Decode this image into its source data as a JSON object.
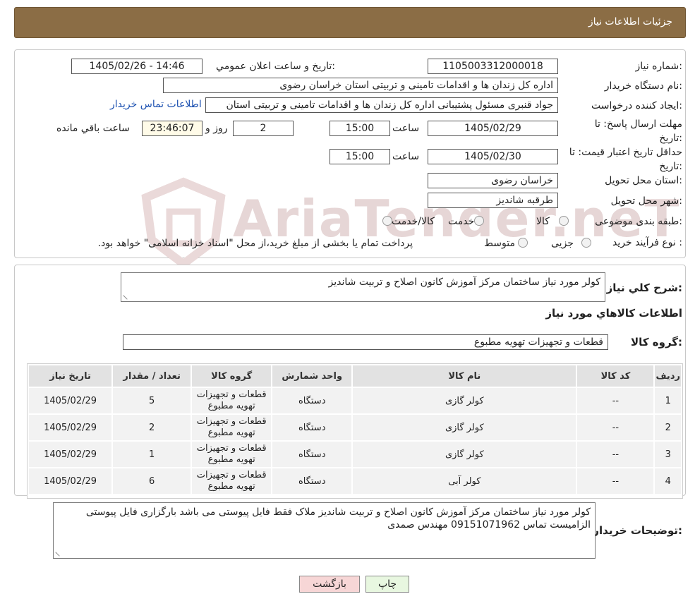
{
  "header": {
    "title": "جزئیات اطلاعات نیاز"
  },
  "watermark": "AriaTender.neT",
  "info": {
    "need_number_label": "شماره نیاز:",
    "need_number": "1105003312000018",
    "announce_label": "تاريخ و ساعت اعلان عمومي:",
    "announce_value": "1405/02/26 - 14:46",
    "buyer_org_label": "نام دستگاه خریدار:",
    "buyer_org": "اداره کل زندان ها و اقدامات تامینی و تربیتی استان خراسان رضوی",
    "creator_label": "ایجاد کننده درخواست:",
    "creator": "جواد قنبری مسئول پشتیبانی اداره کل زندان ها و اقدامات تامینی و تربیتی استان",
    "contact_link": "اطلاعات تماس خریدار",
    "deadline_label": "مهلت ارسال پاسخ: تا تاریخ:",
    "deadline_date": "1405/02/29",
    "time_label": "ساعت",
    "deadline_time": "15:00",
    "days": "2",
    "days_label": "روز و",
    "remaining": "23:46:07",
    "remaining_label": "ساعت باقي مانده",
    "validity_label": "حداقل تاریخ اعتبار قیمت: تا تاریخ:",
    "validity_date": "1405/02/30",
    "validity_time": "15:00",
    "province_label": "استان محل تحویل:",
    "province": "خراسان رضوی",
    "city_label": "شهر محل تحویل:",
    "city": "طرقبه شاندیز",
    "category_label": "طبقه بندی موضوعی:",
    "cat_goods": "کالا",
    "cat_service": "خدمت",
    "cat_both": "کالا/خدمت",
    "process_label": "نوع فرآیند خرید :",
    "proc_minor": "جزیی",
    "proc_medium": "متوسط",
    "proc_note": "پرداخت تمام یا بخشی از مبلغ خرید،از محل \"اسناد خزانه اسلامی\" خواهد بود."
  },
  "summary": {
    "label": "شرح کلي نياز:",
    "text": "کولر مورد نیاز ساختمان مرکز آموزش کانون اصلاح و تربیت شاندیز",
    "goods_info_title": "اطلاعات کالاهاي مورد نياز",
    "group_label": "گروه کالا:",
    "group_value": "قطعات و تجهیزات تهویه مطبوع"
  },
  "table": {
    "headers": [
      "ردیف",
      "کد کالا",
      "نام کالا",
      "واحد شمارش",
      "گروه کالا",
      "تعداد / مقدار",
      "تاریخ نیاز"
    ],
    "rows": [
      [
        "1",
        "--",
        "کولر گازی",
        "دستگاه",
        "قطعات و تجهیزات تهویه مطبوع",
        "5",
        "1405/02/29"
      ],
      [
        "2",
        "--",
        "کولر گازی",
        "دستگاه",
        "قطعات و تجهیزات تهویه مطبوع",
        "2",
        "1405/02/29"
      ],
      [
        "3",
        "--",
        "کولر گازی",
        "دستگاه",
        "قطعات و تجهیزات تهویه مطبوع",
        "1",
        "1405/02/29"
      ],
      [
        "4",
        "--",
        "کولر آبی",
        "دستگاه",
        "قطعات و تجهیزات تهویه مطبوع",
        "6",
        "1405/02/29"
      ]
    ]
  },
  "buyer_notes": {
    "label": "توضیحات خریدار:",
    "text": "کولر مورد نیاز ساختمان مرکز آموزش کانون اصلاح و تربیت شاندیز ملاک فقط فایل پیوستی می باشد بارگزاری فایل پیوستی الزامیست تماس 09151071962 مهندس صمدی"
  },
  "buttons": {
    "print": "چاپ",
    "back": "بازگشت"
  },
  "colors": {
    "header": "#8b6d45",
    "back_button": "#f7d6d6",
    "print_button": "#e8f7e0",
    "link": "#1a4fb0"
  }
}
